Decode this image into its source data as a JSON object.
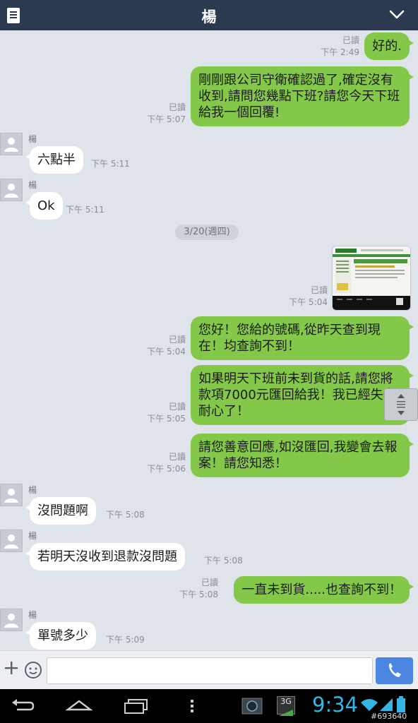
{
  "header": {
    "title": "楊"
  },
  "messages": {
    "m1": {
      "text": "好的.",
      "read": "已讀",
      "time": "下午 2:49"
    },
    "m2": {
      "text": "剛剛跟公司守衛確認過了,確定沒有收到,請問您幾點下班?請您今天下班給我一個回覆!",
      "read": "已讀",
      "time": "下午 5:07"
    },
    "m3": {
      "sender": "楊",
      "text": "六點半",
      "time": "下午 5:11"
    },
    "m4": {
      "sender": "楊",
      "text": "Ok",
      "time": "下午 5:11"
    },
    "date_divider": "3/20(週四)",
    "m5": {
      "read": "已讀",
      "time": "下午 5:04"
    },
    "m6": {
      "text": "您好！您給的號碼,從昨天查到現在！均查詢不到！",
      "read": "已讀",
      "time": "下午 5:04"
    },
    "m7": {
      "text": "如果明天下班前未到貨的話,請您將款項7000元匯回給我！我已經失去耐心了！",
      "read": "已讀",
      "time": "下午 5:05"
    },
    "m8": {
      "text": "請您善意回應,如沒匯回,我變會去報案！請您知悉！",
      "read": "已讀",
      "time": "下午 5:06"
    },
    "m9": {
      "sender": "楊",
      "text": "沒問題啊",
      "time": "下午 5:08"
    },
    "m10": {
      "sender": "楊",
      "text": "若明天沒收到退款沒問題",
      "time": "下午 5:08"
    },
    "m11": {
      "text": "一直未到貨.....也查詢不到！",
      "read": "已讀",
      "time": "下午 5:08"
    },
    "m12": {
      "sender": "楊",
      "text": "單號多少",
      "time": "下午 5:09"
    }
  },
  "input": {
    "placeholder": ""
  },
  "statusbar": {
    "clock": "9:34",
    "network": "3G",
    "watermark": "#693640"
  },
  "colors": {
    "header": "#2c3a4f",
    "my_bubble": "#84c84a",
    "their_bubble": "#ffffff",
    "background": "#dfe3ea",
    "call_button": "#4b87e0",
    "clock": "#34b5e5"
  },
  "icons": [
    "menu-icon",
    "chevron-down-icon",
    "avatar-icon",
    "plus-icon",
    "emoji-icon",
    "phone-icon",
    "back-icon",
    "home-icon",
    "recent-apps-icon",
    "overflow-menu-icon",
    "wifi-icon",
    "signal-icon",
    "battery-icon"
  ]
}
